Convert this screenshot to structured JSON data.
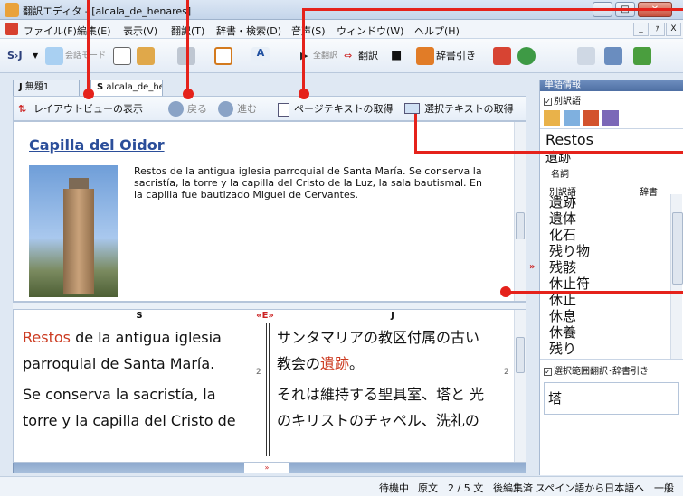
{
  "window": {
    "title": "翻訳エディタ - [alcala_de_henares]",
    "min": "─",
    "max": "□",
    "close": "✕"
  },
  "menu": {
    "items": [
      "ファイル(F)",
      "編集(E)",
      "表示(V)",
      "翻訳(T)",
      "辞書・検索(D)",
      "音声(S)",
      "ウィンドウ(W)",
      "ヘルプ(H)"
    ],
    "mdi_min": "_",
    "mdi_max": "ｧ",
    "mdi_close": "X"
  },
  "toolbar": {
    "direction": "S›J",
    "conversation_mode": "会話モード",
    "translate_all": "全翻訳",
    "translate": "翻訳",
    "dictionary_lookup": "辞書引き"
  },
  "tabs": [
    {
      "prefix": "J",
      "label": "無題1"
    },
    {
      "prefix": "S",
      "label": "alcala_de_henares"
    }
  ],
  "nav": {
    "layout_view": "レイアウトビューの表示",
    "back": "戻る",
    "forward": "進む",
    "get_page_text": "ページテキストの取得",
    "get_selected_text": "選択テキストの取得"
  },
  "page": {
    "title": "Capilla del Oidor",
    "body": "Restos de la antigua iglesia parroquial de Santa María. Se conserva la sacristía, la torre y la capilla del Cristo de la Luz, la sala bautismal. En la capilla fue bautizado Miguel de Cervantes."
  },
  "parallel": {
    "source_header": "S",
    "swap": "«E»",
    "target_header": "J",
    "s1_word": "Restos",
    "s1_rest": "de la antigua iglesia",
    "s1_line2": "parroquial de Santa María.",
    "j1_line1": "サンタマリアの教区付属の古い",
    "j1_pre": "教会の",
    "j1_word": "遺跡",
    "j1_post": "。",
    "s2_line1": "Se conserva la sacristía, la",
    "s2_line2": "torre y la capilla del Cristo de",
    "j2_line1": "それは維持する聖具室、塔と 光",
    "j2_line2": "のキリストのチャペル、洗礼の",
    "num": "2",
    "expand": "»"
  },
  "word_info": {
    "header": "単語情報",
    "alt_check": "別訳語",
    "headword": "Restos",
    "translation": "遺跡",
    "pos": "名詞",
    "col_alt": "別訳語",
    "col_dict": "辞書",
    "alternatives": [
      "遺跡",
      "遺体",
      "化石",
      "残り物",
      "残骸",
      "休止符",
      "休止",
      "休息",
      "休養",
      "残り"
    ],
    "selected_check": "選択範囲翻訳･辞書引き",
    "selected_word": "塔",
    "collapse": "»"
  },
  "status": {
    "state": "待機中",
    "original": "原文",
    "sentences": "2 / 5 文",
    "postedit": "後編集済",
    "direction": "スペイン語から日本語へ",
    "field": "一般"
  }
}
